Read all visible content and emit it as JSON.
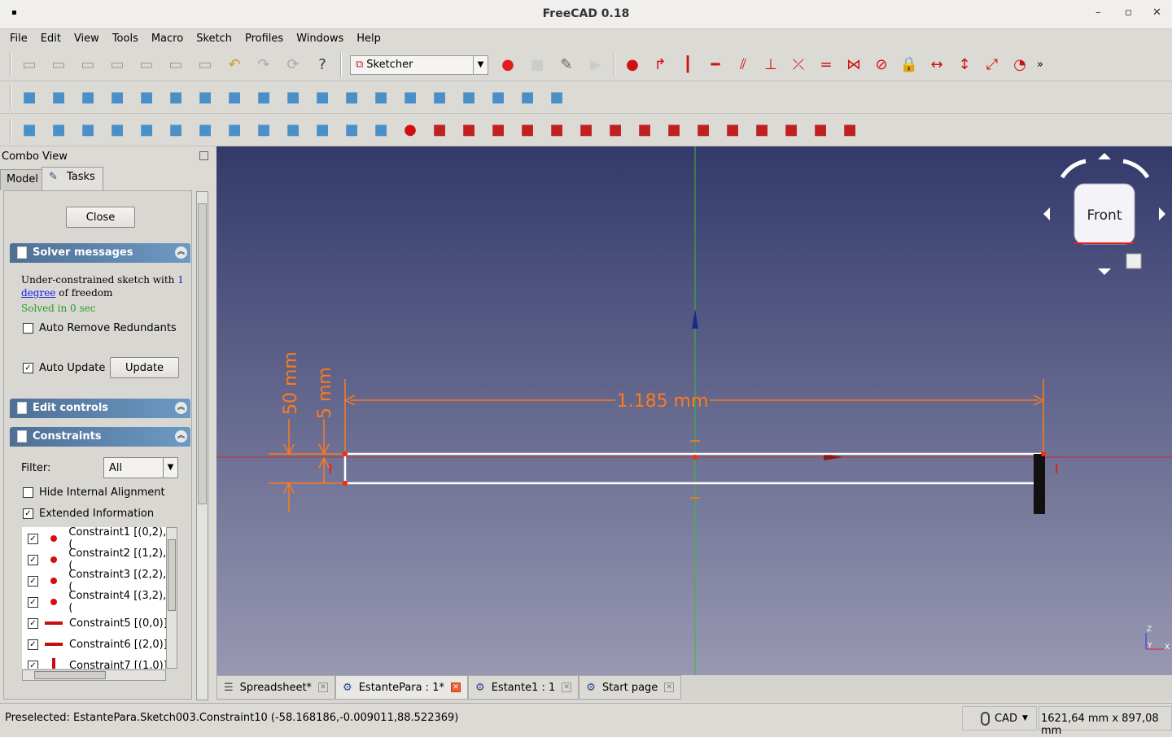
{
  "window": {
    "title": "FreeCAD 0.18",
    "minimize": "–",
    "maximize": "▫",
    "close": "✕"
  },
  "menu": [
    "File",
    "Edit",
    "View",
    "Tools",
    "Macro",
    "Sketch",
    "Profiles",
    "Windows",
    "Help"
  ],
  "toolbar1": {
    "left_icons": [
      "new-file",
      "open-file",
      "import",
      "print",
      "cut",
      "copy",
      "paste",
      "undo",
      "redo",
      "refresh",
      "whats-this"
    ],
    "workbench": "Sketcher",
    "macro_icons": [
      "record-macro",
      "stop-macro",
      "edit-macro",
      "run-macro"
    ],
    "sketch_icons": [
      "point",
      "tangent-arc",
      "vertical",
      "horizontal",
      "parallel",
      "perpendicular",
      "tangent",
      "equal",
      "symmetric",
      "block",
      "lock",
      "horizontal-distance",
      "vertical-distance",
      "distance",
      "radius"
    ]
  },
  "toolbar2": {
    "icons": [
      "fit-all",
      "fit-selection",
      "draw-style",
      "isometric",
      "front",
      "top",
      "right",
      "rear",
      "bottom",
      "left",
      "measure",
      "part",
      "group",
      "std-view",
      "export",
      "save-view",
      "view-section",
      "map-sketch",
      "view-sketch"
    ]
  },
  "toolbar3": {
    "icons": [
      "new-sketch",
      "leave-sketch",
      "close-shape",
      "connect",
      "select-constraints",
      "select-origin",
      "select-h-axis",
      "select-v-axis",
      "select-elements",
      "redundant",
      "conflicting",
      "grid",
      "switch-virtual",
      "point",
      "line",
      "arc",
      "circle",
      "conic",
      "bspline",
      "polyline",
      "rectangle",
      "polygon",
      "slot",
      "fillet",
      "trim",
      "extend",
      "external",
      "carbon-copy",
      "construction"
    ]
  },
  "combo": {
    "title": "Combo View",
    "tabs": [
      "Model",
      "Tasks"
    ],
    "close_button": "Close",
    "solver": {
      "header": "Solver messages",
      "msg_pre": "Under-constrained sketch with ",
      "link1": "1",
      "link2": "degree",
      "msg_post": " of freedom",
      "solved": "Solved in 0 sec",
      "auto_remove": "Auto Remove Redundants",
      "auto_update": "Auto Update",
      "update_button": "Update"
    },
    "edit_controls": "Edit controls",
    "constraints": {
      "header": "Constraints",
      "filter_label": "Filter:",
      "filter_value": "All",
      "hide_internal": "Hide Internal Alignment",
      "extended_info": "Extended Information",
      "items": [
        {
          "label": "Constraint1 [(0,2),(",
          "type": "coincident"
        },
        {
          "label": "Constraint2 [(1,2),(",
          "type": "coincident"
        },
        {
          "label": "Constraint3 [(2,2),(",
          "type": "coincident"
        },
        {
          "label": "Constraint4 [(3,2),(",
          "type": "coincident"
        },
        {
          "label": "Constraint5 [(0,0)]",
          "type": "horizontal"
        },
        {
          "label": "Constraint6 [(2,0)]",
          "type": "horizontal"
        },
        {
          "label": "Constraint7 [(1,0)]",
          "type": "vertical"
        }
      ]
    }
  },
  "viewport": {
    "dims": {
      "length": "1.185 mm",
      "height50": "50 mm",
      "height5": "5 mm"
    },
    "navcube": "Front",
    "axis": {
      "z": "Z",
      "y": "Y",
      "x": "X"
    }
  },
  "doc_tabs": [
    {
      "label": "Spreadsheet*",
      "active": false
    },
    {
      "label": "EstantePara : 1*",
      "active": true
    },
    {
      "label": "Estante1 : 1",
      "active": false
    },
    {
      "label": "Start page",
      "active": false
    }
  ],
  "status": {
    "text": "Preselected: EstantePara.Sketch003.Constraint10 (-58.168186,-0.009011,88.522369)",
    "nav_style": "CAD",
    "dimensions": "1621,64 mm x 897,08 mm"
  },
  "colors": {
    "sketch_orange": "#ff7a1a",
    "constraint_red": "#cc1010",
    "header_blue": "#5b82ac"
  }
}
